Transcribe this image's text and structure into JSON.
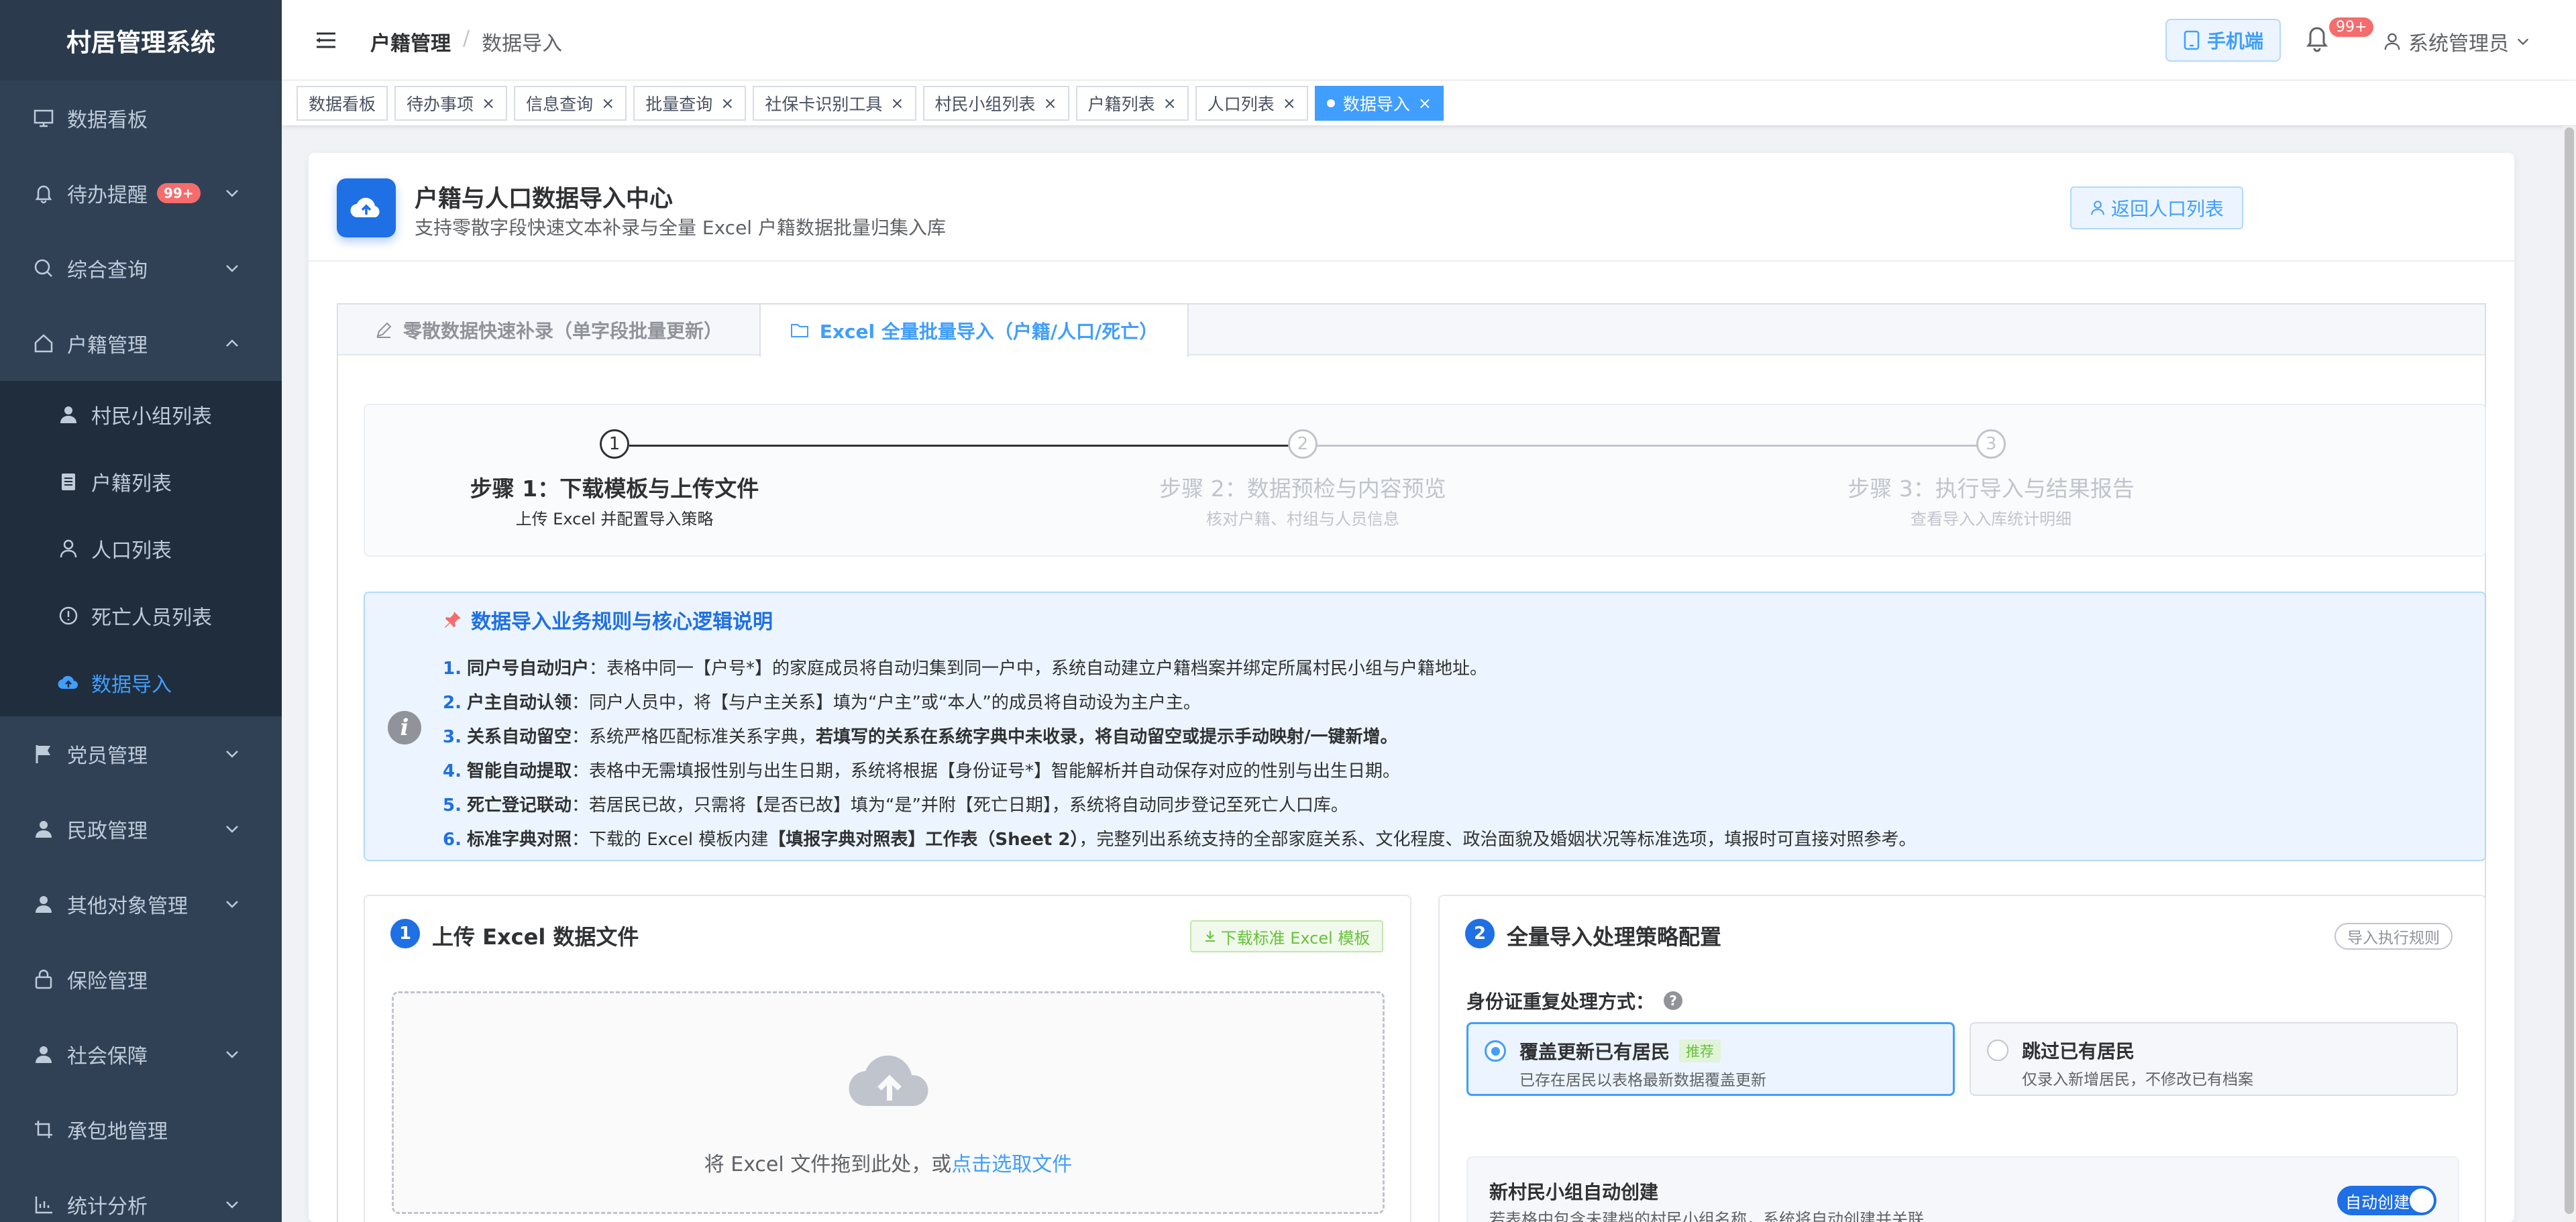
{
  "sidebar": {
    "title": "村居管理系统",
    "items": [
      {
        "label": "数据看板",
        "icon": "monitor-icon"
      },
      {
        "label": "待办提醒",
        "icon": "bell-icon",
        "badge": "99+"
      },
      {
        "label": "综合查询",
        "icon": "search-icon"
      },
      {
        "label": "户籍管理",
        "icon": "home-icon"
      },
      {
        "label": "党员管理",
        "icon": "flag-icon"
      },
      {
        "label": "民政管理",
        "icon": "user-icon"
      },
      {
        "label": "其他对象管理",
        "icon": "user-icon"
      },
      {
        "label": "保险管理",
        "icon": "lock-icon"
      },
      {
        "label": "社会保障",
        "icon": "user-icon"
      },
      {
        "label": "承包地管理",
        "icon": "crop-icon"
      },
      {
        "label": "统计分析",
        "icon": "chart-icon"
      }
    ],
    "subitems": [
      {
        "label": "村民小组列表",
        "icon": "user-icon"
      },
      {
        "label": "户籍列表",
        "icon": "document-icon"
      },
      {
        "label": "人口列表",
        "icon": "user-outline-icon"
      },
      {
        "label": "死亡人员列表",
        "icon": "info-circle-icon"
      },
      {
        "label": "数据导入",
        "icon": "cloud-upload-icon"
      }
    ]
  },
  "header": {
    "breadcrumb": [
      "户籍管理",
      "数据导入"
    ],
    "separator": "/",
    "mobile_label": "手机端",
    "bell_badge": "99+",
    "user_name": "系统管理员"
  },
  "tags": [
    "数据看板",
    "待办事项",
    "信息查询",
    "批量查询",
    "社保卡识别工具",
    "村民小组列表",
    "户籍列表",
    "人口列表",
    "数据导入"
  ],
  "page": {
    "title": "户籍与人口数据导入中心",
    "subtitle": "支持零散字段快速文本补录与全量 Excel 户籍数据批量归集入库",
    "back_label": "返回人口列表"
  },
  "tabs": [
    {
      "label": "零散数据快速补录（单字段批量更新）",
      "icon": "edit-icon"
    },
    {
      "label": "Excel 全量批量导入（户籍/人口/死亡）",
      "icon": "folder-icon"
    }
  ],
  "steps": [
    {
      "num": "1",
      "title": "步骤 1：下载模板与上传文件",
      "desc": "上传 Excel 并配置导入策略"
    },
    {
      "num": "2",
      "title": "步骤 2：数据预检与内容预览",
      "desc": "核对户籍、村组与人员信息"
    },
    {
      "num": "3",
      "title": "步骤 3：执行导入与结果报告",
      "desc": "查看导入入库统计明细"
    }
  ],
  "rules": {
    "title": "数据导入业务规则与核心逻辑说明",
    "items": [
      {
        "num": "1.",
        "head": "同户号自动归户",
        "body": "：表格中同一【户号*】的家庭成员将自动归集到同一户中，系统自动建立户籍档案并绑定所属村民小组与户籍地址。",
        "bold": "",
        "tail": ""
      },
      {
        "num": "2.",
        "head": "户主自动认领",
        "body": "：同户人员中，将【与户主关系】填为“户主”或“本人”的成员将自动设为主户主。",
        "bold": "",
        "tail": ""
      },
      {
        "num": "3.",
        "head": "关系自动留空",
        "body": "：系统严格匹配标准关系字典，",
        "bold": "若填写的关系在系统字典中未收录，将自动留空或提示手动映射/一键新增。",
        "tail": ""
      },
      {
        "num": "4.",
        "head": "智能自动提取",
        "body": "：表格中无需填报性别与出生日期，系统将根据【身份证号*】智能解析并自动保存对应的性别与出生日期。",
        "bold": "",
        "tail": ""
      },
      {
        "num": "5.",
        "head": "死亡登记联动",
        "body": "：若居民已故，只需将【是否已故】填为“是”并附【死亡日期】，系统将自动同步登记至死亡人口库。",
        "bold": "",
        "tail": ""
      },
      {
        "num": "6.",
        "head": "标准字典对照",
        "body": "：下载的 Excel 模板内建",
        "bold": "【填报字典对照表】工作表（Sheet 2）",
        "tail": "，完整列出系统支持的全部家庭关系、文化程度、政治面貌及婚姻状况等标准选项，填报时可直接对照参考。"
      }
    ]
  },
  "upload": {
    "num": "1",
    "title": "上传 Excel 数据文件",
    "download_label": "下载标准 Excel 模板",
    "drop_text": "将 Excel 文件拖到此处，或",
    "drop_link": "点击选取文件"
  },
  "strategy": {
    "num": "2",
    "title": "全量导入处理策略配置",
    "rule_label": "导入执行规则",
    "dup_label": "身份证重复处理方式：",
    "options": [
      {
        "title": "覆盖更新已有居民",
        "tag": "推荐",
        "desc": "已存在居民以表格最新数据覆盖更新",
        "selected": true
      },
      {
        "title": "跳过已有居民",
        "tag": "",
        "desc": "仅录入新增居民，不修改已有档案",
        "selected": false
      }
    ],
    "auto_title": "新村民小组自动创建",
    "auto_desc": "若表格中包含未建档的村民小组名称，系统将自动创建并关联",
    "auto_switch": "自动创建"
  },
  "colors": {
    "sidebar": "#304156",
    "accent": "#409eff",
    "primary": "#1f6fe5",
    "danger": "#f56c6c",
    "success": "#67c23a"
  }
}
